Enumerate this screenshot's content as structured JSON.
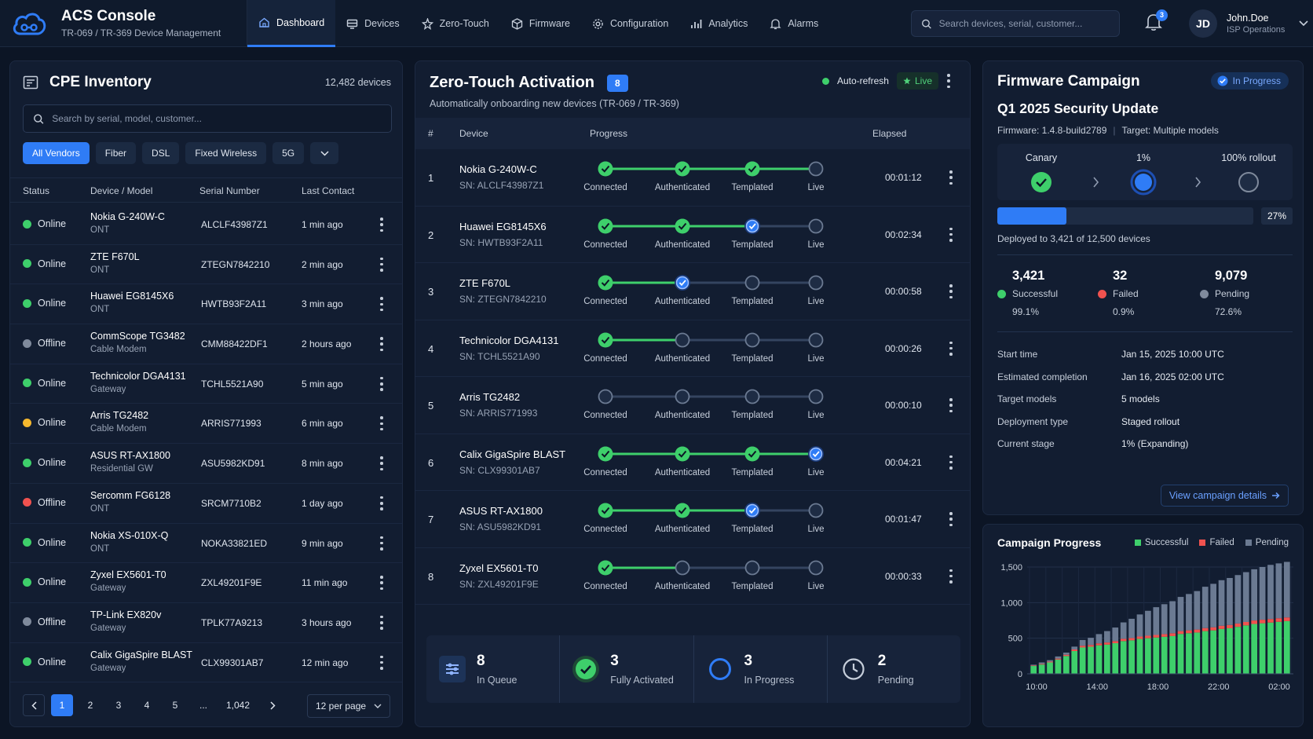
{
  "app": {
    "title": "ACS Console",
    "subtitle": "TR-069 / TR-369 Device Management"
  },
  "nav": [
    {
      "label": "Dashboard",
      "icon": "home-icon",
      "active": true
    },
    {
      "label": "Devices",
      "icon": "devices-icon"
    },
    {
      "label": "Zero-Touch",
      "icon": "zero-touch-icon"
    },
    {
      "label": "Firmware",
      "icon": "firmware-icon"
    },
    {
      "label": "Configuration",
      "icon": "gear-icon"
    },
    {
      "label": "Analytics",
      "icon": "bar-chart-icon"
    },
    {
      "label": "Alarms",
      "icon": "bell-icon"
    }
  ],
  "search": {
    "placeholder": "Search devices, serial, customer..."
  },
  "notifications": {
    "count": "3"
  },
  "user": {
    "initials": "JD",
    "name": "John.Doe",
    "role": "ISP Operations"
  },
  "colors": {
    "accent": "#2f7cf6",
    "online": "#3ecf6b",
    "offline": "#7f8a9c",
    "warning": "#f5b82e",
    "error": "#f0524f"
  },
  "inventory": {
    "title": "CPE Inventory",
    "count": "12,482 devices",
    "search_placeholder": "Search by serial, model, customer...",
    "filters": [
      "All Vendors",
      "Fiber",
      "DSL",
      "Fixed Wireless",
      "5G"
    ],
    "columns": [
      "Status",
      "Device / Model",
      "Serial Number",
      "Last Contact"
    ],
    "rows": [
      {
        "status": "Online",
        "color": "online",
        "name": "Nokia G-240W-C",
        "type": "ONT",
        "serial": "ALCLF43987Z1",
        "last": "1 min ago"
      },
      {
        "status": "Online",
        "color": "online",
        "name": "ZTE F670L",
        "type": "ONT",
        "serial": "ZTEGN7842210",
        "last": "2 min ago"
      },
      {
        "status": "Online",
        "color": "online",
        "name": "Huawei EG8145X6",
        "type": "ONT",
        "serial": "HWTB93F2A11",
        "last": "3 min ago"
      },
      {
        "status": "Offline",
        "color": "offline",
        "name": "CommScope TG3482",
        "type": "Cable Modem",
        "serial": "CMM88422DF1",
        "last": "2 hours ago"
      },
      {
        "status": "Online",
        "color": "online",
        "name": "Technicolor DGA4131",
        "type": "Gateway",
        "serial": "TCHL5521A90",
        "last": "5 min ago"
      },
      {
        "status": "Online",
        "color": "warning",
        "name": "Arris TG2482",
        "type": "Cable Modem",
        "serial": "ARRIS771993",
        "last": "6 min ago"
      },
      {
        "status": "Online",
        "color": "online",
        "name": "ASUS RT-AX1800",
        "type": "Residential GW",
        "serial": "ASU5982KD91",
        "last": "8 min ago"
      },
      {
        "status": "Offline",
        "color": "error",
        "name": "Sercomm FG6128",
        "type": "ONT",
        "serial": "SRCM7710B2",
        "last": "1 day ago"
      },
      {
        "status": "Online",
        "color": "online",
        "name": "Nokia XS-010X-Q",
        "type": "ONT",
        "serial": "NOKA33821ED",
        "last": "9 min ago"
      },
      {
        "status": "Online",
        "color": "online",
        "name": "Zyxel EX5601-T0",
        "type": "Gateway",
        "serial": "ZXL49201F9E",
        "last": "11 min ago"
      },
      {
        "status": "Offline",
        "color": "offline",
        "name": "TP-Link EX820v",
        "type": "Gateway",
        "serial": "TPLK77A9213",
        "last": "3 hours ago"
      },
      {
        "status": "Online",
        "color": "online",
        "name": "Calix GigaSpire BLAST",
        "type": "Gateway",
        "serial": "CLX99301AB7",
        "last": "12 min ago"
      }
    ],
    "pages": [
      "1",
      "2",
      "3",
      "4",
      "5",
      "...",
      "1,042"
    ],
    "per_page": "12 per page"
  },
  "zero_touch": {
    "title": "Zero-Touch Activation",
    "badge": "8",
    "subtitle": "Automatically onboarding new devices (TR-069 / TR-369)",
    "auto_refresh": "Auto-refresh",
    "live": "Live",
    "columns": [
      "#",
      "Device",
      "Progress",
      "Elapsed"
    ],
    "stages": [
      "Connected",
      "Authenticated",
      "Templated",
      "Live"
    ],
    "rows": [
      {
        "num": "1",
        "name": "Nokia G-240W-C",
        "sn": "SN: ALCLF43987Z1",
        "done": 3,
        "current": -1,
        "elapsed": "00:01:12"
      },
      {
        "num": "2",
        "name": "Huawei EG8145X6",
        "sn": "SN: HWTB93F2A11",
        "done": 2,
        "current": 2,
        "elapsed": "00:02:34"
      },
      {
        "num": "3",
        "name": "ZTE F670L",
        "sn": "SN: ZTEGN7842210",
        "done": 1,
        "current": 1,
        "elapsed": "00:00:58"
      },
      {
        "num": "4",
        "name": "Technicolor DGA4131",
        "sn": "SN: TCHL5521A90",
        "done": 1,
        "current": -1,
        "elapsed": "00:00:26"
      },
      {
        "num": "5",
        "name": "Arris TG2482",
        "sn": "SN: ARRIS771993",
        "done": 0,
        "current": -1,
        "elapsed": "00:00:10"
      },
      {
        "num": "6",
        "name": "Calix GigaSpire BLAST",
        "sn": "SN: CLX99301AB7",
        "done": 3,
        "current": 3,
        "elapsed": "00:04:21"
      },
      {
        "num": "7",
        "name": "ASUS RT-AX1800",
        "sn": "SN: ASU5982KD91",
        "done": 2,
        "current": 2,
        "elapsed": "00:01:47"
      },
      {
        "num": "8",
        "name": "Zyxel EX5601-T0",
        "sn": "SN: ZXL49201F9E",
        "done": 1,
        "current": -1,
        "elapsed": "00:00:33"
      }
    ],
    "summary": [
      {
        "value": "8",
        "label": "In Queue",
        "icon": "queue-icon"
      },
      {
        "value": "3",
        "label": "Fully Activated",
        "icon": "check-circle-icon"
      },
      {
        "value": "3",
        "label": "In Progress",
        "icon": "progress-ring-icon"
      },
      {
        "value": "2",
        "label": "Pending",
        "icon": "clock-icon"
      }
    ]
  },
  "firmware": {
    "title": "Firmware Campaign",
    "status": "In Progress",
    "name": "Q1 2025 Security Update",
    "firmware": "Firmware: 1.4.8-build2789",
    "target": "Target: Multiple models",
    "stages": [
      "Canary",
      "1%",
      "100% rollout"
    ],
    "progress_pct": 27,
    "progress_label": "27%",
    "deployed": "Deployed to 3,421 of 12,500 devices",
    "stats": [
      {
        "value": "3,421",
        "label": "Successful",
        "pct": "99.1%",
        "color": "#3ecf6b"
      },
      {
        "value": "32",
        "label": "Failed",
        "pct": "0.9%",
        "color": "#f0524f"
      },
      {
        "value": "9,079",
        "label": "Pending",
        "pct": "72.6%",
        "color": "#7f8a9c"
      }
    ],
    "details": [
      {
        "k": "Start time",
        "v": "Jan 15, 2025 10:00 UTC"
      },
      {
        "k": "Estimated completion",
        "v": "Jan 16, 2025 02:00 UTC"
      },
      {
        "k": "Target models",
        "v": "5 models"
      },
      {
        "k": "Deployment type",
        "v": "Staged rollout"
      },
      {
        "k": "Current stage",
        "v": "1% (Expanding)"
      }
    ],
    "link": "View campaign details"
  },
  "chart_data": {
    "type": "bar",
    "title": "Campaign Progress",
    "x_ticks": [
      "10:00",
      "14:00",
      "18:00",
      "22:00",
      "02:00"
    ],
    "y_ticks": [
      "0",
      "500",
      "1,000",
      "1,500"
    ],
    "ylim": [
      0,
      1500
    ],
    "legend": "top-right",
    "series": [
      {
        "name": "Successful",
        "color": "#3ecf6b",
        "values": [
          110,
          130,
          160,
          200,
          250,
          320,
          370,
          380,
          400,
          410,
          430,
          460,
          470,
          490,
          500,
          510,
          520,
          530,
          560,
          570,
          580,
          600,
          610,
          630,
          640,
          660,
          680,
          700,
          710,
          720,
          730,
          740
        ]
      },
      {
        "name": "Failed",
        "color": "#f0524f",
        "values": [
          8,
          10,
          12,
          14,
          18,
          22,
          25,
          26,
          28,
          30,
          30,
          32,
          33,
          34,
          35,
          36,
          38,
          40,
          40,
          41,
          42,
          43,
          44,
          45,
          46,
          47,
          48,
          49,
          50,
          50,
          51,
          52
        ]
      },
      {
        "name": "Pending",
        "color": "#6b7a92",
        "values": [
          10,
          20,
          20,
          30,
          30,
          40,
          80,
          100,
          130,
          160,
          190,
          230,
          270,
          310,
          350,
          390,
          420,
          450,
          480,
          510,
          540,
          580,
          610,
          640,
          660,
          680,
          700,
          720,
          740,
          760,
          770,
          780
        ]
      }
    ]
  }
}
